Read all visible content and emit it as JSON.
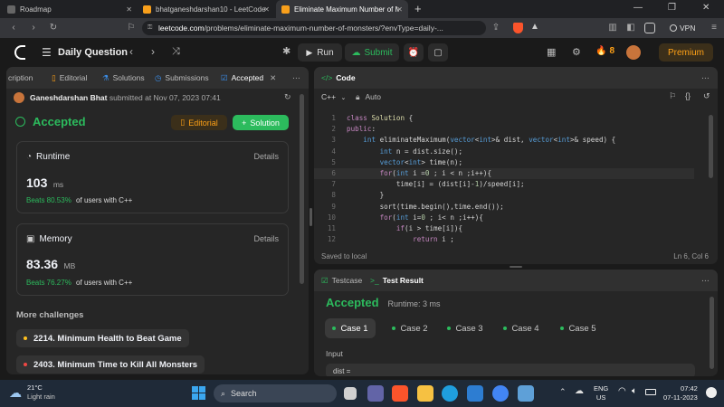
{
  "browser": {
    "tabs": [
      {
        "title": "Roadmap"
      },
      {
        "title": "bhatganeshdarshan10 - LeetCode Pro"
      },
      {
        "title": "Eliminate Maximum Number of M"
      }
    ],
    "url_host": "leetcode.com",
    "url_path": "/problems/eliminate-maximum-number-of-monsters/?envType=daily-...",
    "vpn": "VPN"
  },
  "nav": {
    "title": "Daily Question",
    "run": "Run",
    "submit": "Submit",
    "streak": "8",
    "premium": "Premium"
  },
  "left": {
    "tabs": [
      "cription",
      "Editorial",
      "Solutions",
      "Submissions",
      "Accepted"
    ],
    "submitter": "Ganeshdarshan Bhat",
    "submitted_at": "submitted at Nov 07, 2023 07:41",
    "status": "Accepted",
    "editorial_btn": "Editorial",
    "solution_btn": "Solution",
    "runtime": {
      "label": "Runtime",
      "details": "Details",
      "value": "103",
      "unit": "ms",
      "beats": "Beats 80.53%",
      "beats_suffix": "of users with C++"
    },
    "memory": {
      "label": "Memory",
      "details": "Details",
      "value": "83.36",
      "unit": "MB",
      "beats": "Beats 76.27%",
      "beats_suffix": "of users with C++"
    },
    "more_challenges": "More challenges",
    "challenges": [
      {
        "title": "2214. Minimum Health to Beat Game",
        "color": "#ffc01e"
      },
      {
        "title": "2403. Minimum Time to Kill All Monsters",
        "color": "#ef4743"
      }
    ]
  },
  "code": {
    "title": "Code",
    "lang": "C++",
    "mode": "Auto",
    "lines": [
      {
        "n": "1",
        "t": "class Solution {"
      },
      {
        "n": "2",
        "t": "public:"
      },
      {
        "n": "3",
        "t": "    int eliminateMaximum(vector<int>& dist, vector<int>& speed) {"
      },
      {
        "n": "4",
        "t": "        int n = dist.size();"
      },
      {
        "n": "5",
        "t": "        vector<int> time(n);"
      },
      {
        "n": "6",
        "t": "        for(int i =0 ; i < n ;i++){"
      },
      {
        "n": "7",
        "t": "            time[i] = (dist[i]-1)/speed[i];"
      },
      {
        "n": "8",
        "t": "        }"
      },
      {
        "n": "9",
        "t": "        sort(time.begin(),time.end());"
      },
      {
        "n": "10",
        "t": "        for(int i=0 ; i< n ;i++){"
      },
      {
        "n": "11",
        "t": "            if(i > time[i]){"
      },
      {
        "n": "12",
        "t": "                return i ;"
      }
    ],
    "saved": "Saved to local",
    "cursor": "Ln 6, Col 6"
  },
  "result": {
    "tab_testcase": "Testcase",
    "tab_result": "Test Result",
    "status": "Accepted",
    "runtime": "Runtime: 3 ms",
    "cases": [
      "Case 1",
      "Case 2",
      "Case 3",
      "Case 4",
      "Case 5"
    ],
    "input_label": "Input",
    "input_value": "dist ="
  },
  "taskbar": {
    "temp": "21°C",
    "weather": "Light rain",
    "search": "Search",
    "lang1": "ENG",
    "lang2": "US",
    "time": "07:42",
    "date": "07-11-2023"
  }
}
